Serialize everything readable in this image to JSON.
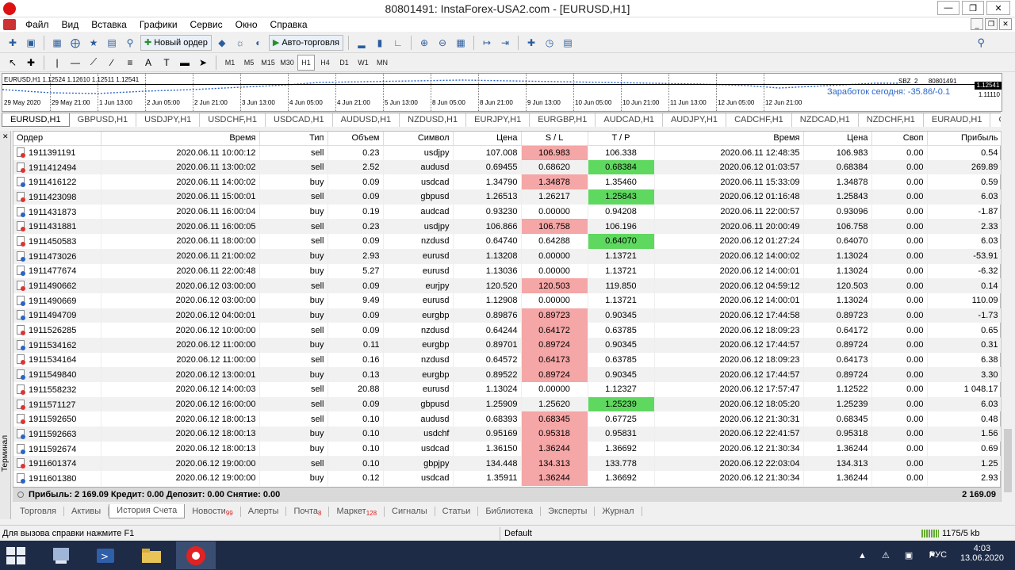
{
  "window": {
    "title": "80801491: InstaForex-USA2.com - [EURUSD,H1]"
  },
  "menu": [
    "Файл",
    "Вид",
    "Вставка",
    "Графики",
    "Сервис",
    "Окно",
    "Справка"
  ],
  "toolbar": {
    "new_order": "Новый ордер",
    "auto_trading": "Авто-торговля"
  },
  "timeframes": [
    "M1",
    "M5",
    "M15",
    "M30",
    "H1",
    "H4",
    "D1",
    "W1",
    "MN"
  ],
  "selected_timeframe": "H1",
  "chart": {
    "header": "EURUSD,H1  1.12524 1.12610 1.12511 1.12541",
    "expert": "SBZ_2",
    "account": "80801491",
    "earnings": "Заработок сегодня: -35.86/-0.1",
    "price": "1.12541",
    "price2": "1.11110",
    "xlabels": [
      "29 May 2020",
      "29 May 21:00",
      "1 Jun 13:00",
      "2 Jun 05:00",
      "2 Jun 21:00",
      "3 Jun 13:00",
      "4 Jun 05:00",
      "4 Jun 21:00",
      "5 Jun 13:00",
      "8 Jun 05:00",
      "8 Jun 21:00",
      "9 Jun 13:00",
      "10 Jun 05:00",
      "10 Jun 21:00",
      "11 Jun 13:00",
      "12 Jun 05:00",
      "12 Jun 21:00"
    ]
  },
  "symbol_tabs": [
    "EURUSD,H1",
    "GBPUSD,H1",
    "USDJPY,H1",
    "USDCHF,H1",
    "USDCAD,H1",
    "AUDUSD,H1",
    "NZDUSD,H1",
    "EURJPY,H1",
    "EURGBP,H1",
    "AUDCAD,H1",
    "AUDJPY,H1",
    "CADCHF,H1",
    "NZDCAD,H1",
    "NZDCHF,H1",
    "EURAUD,H1",
    "GBPCI"
  ],
  "columns": [
    "Ордер",
    "Время",
    "Тип",
    "Объем",
    "Символ",
    "Цена",
    "S / L",
    "T / P",
    "Время",
    "Цена",
    "Своп",
    "Прибыль"
  ],
  "rows": [
    [
      "1911391191",
      "2020.06.11 10:00:12",
      "sell",
      "0.23",
      "usdjpy",
      "107.008",
      "106.983",
      "106.338",
      "2020.06.11 12:48:35",
      "106.983",
      "0.00",
      "0.54",
      "red",
      ""
    ],
    [
      "1911412494",
      "2020.06.11 13:00:02",
      "sell",
      "2.52",
      "audusd",
      "0.69455",
      "0.68620",
      "0.68384",
      "2020.06.12 01:03:57",
      "0.68384",
      "0.00",
      "269.89",
      "",
      "green"
    ],
    [
      "1911416122",
      "2020.06.11 14:00:02",
      "buy",
      "0.09",
      "usdcad",
      "1.34790",
      "1.34878",
      "1.35460",
      "2020.06.11 15:33:09",
      "1.34878",
      "0.00",
      "0.59",
      "red",
      ""
    ],
    [
      "1911423098",
      "2020.06.11 15:00:01",
      "sell",
      "0.09",
      "gbpusd",
      "1.26513",
      "1.26217",
      "1.25843",
      "2020.06.12 01:16:48",
      "1.25843",
      "0.00",
      "6.03",
      "",
      "green"
    ],
    [
      "1911431873",
      "2020.06.11 16:00:04",
      "buy",
      "0.19",
      "audcad",
      "0.93230",
      "0.00000",
      "0.94208",
      "2020.06.11 22:00:57",
      "0.93096",
      "0.00",
      "-1.87",
      "",
      ""
    ],
    [
      "1911431881",
      "2020.06.11 16:00:05",
      "sell",
      "0.23",
      "usdjpy",
      "106.866",
      "106.758",
      "106.196",
      "2020.06.11 20:00:49",
      "106.758",
      "0.00",
      "2.33",
      "red",
      ""
    ],
    [
      "1911450583",
      "2020.06.11 18:00:00",
      "sell",
      "0.09",
      "nzdusd",
      "0.64740",
      "0.64288",
      "0.64070",
      "2020.06.12 01:27:24",
      "0.64070",
      "0.00",
      "6.03",
      "",
      "green"
    ],
    [
      "1911473026",
      "2020.06.11 21:00:02",
      "buy",
      "2.93",
      "eurusd",
      "1.13208",
      "0.00000",
      "1.13721",
      "2020.06.12 14:00:02",
      "1.13024",
      "0.00",
      "-53.91",
      "",
      ""
    ],
    [
      "1911477674",
      "2020.06.11 22:00:48",
      "buy",
      "5.27",
      "eurusd",
      "1.13036",
      "0.00000",
      "1.13721",
      "2020.06.12 14:00:01",
      "1.13024",
      "0.00",
      "-6.32",
      "",
      ""
    ],
    [
      "1911490662",
      "2020.06.12 03:00:00",
      "sell",
      "0.09",
      "eurjpy",
      "120.520",
      "120.503",
      "119.850",
      "2020.06.12 04:59:12",
      "120.503",
      "0.00",
      "0.14",
      "red",
      ""
    ],
    [
      "1911490669",
      "2020.06.12 03:00:00",
      "buy",
      "9.49",
      "eurusd",
      "1.12908",
      "0.00000",
      "1.13721",
      "2020.06.12 14:00:01",
      "1.13024",
      "0.00",
      "110.09",
      "",
      ""
    ],
    [
      "1911494709",
      "2020.06.12 04:00:01",
      "buy",
      "0.09",
      "eurgbp",
      "0.89876",
      "0.89723",
      "0.90345",
      "2020.06.12 17:44:58",
      "0.89723",
      "0.00",
      "-1.73",
      "red",
      ""
    ],
    [
      "1911526285",
      "2020.06.12 10:00:00",
      "sell",
      "0.09",
      "nzdusd",
      "0.64244",
      "0.64172",
      "0.63785",
      "2020.06.12 18:09:23",
      "0.64172",
      "0.00",
      "0.65",
      "red",
      ""
    ],
    [
      "1911534162",
      "2020.06.12 11:00:00",
      "buy",
      "0.11",
      "eurgbp",
      "0.89701",
      "0.89724",
      "0.90345",
      "2020.06.12 17:44:57",
      "0.89724",
      "0.00",
      "0.31",
      "red",
      ""
    ],
    [
      "1911534164",
      "2020.06.12 11:00:00",
      "sell",
      "0.16",
      "nzdusd",
      "0.64572",
      "0.64173",
      "0.63785",
      "2020.06.12 18:09:23",
      "0.64173",
      "0.00",
      "6.38",
      "red",
      ""
    ],
    [
      "1911549840",
      "2020.06.12 13:00:01",
      "buy",
      "0.13",
      "eurgbp",
      "0.89522",
      "0.89724",
      "0.90345",
      "2020.06.12 17:44:57",
      "0.89724",
      "0.00",
      "3.30",
      "red",
      ""
    ],
    [
      "1911558232",
      "2020.06.12 14:00:03",
      "sell",
      "20.88",
      "eurusd",
      "1.13024",
      "0.00000",
      "1.12327",
      "2020.06.12 17:57:47",
      "1.12522",
      "0.00",
      "1 048.17",
      "",
      ""
    ],
    [
      "1911571127",
      "2020.06.12 16:00:00",
      "sell",
      "0.09",
      "gbpusd",
      "1.25909",
      "1.25620",
      "1.25239",
      "2020.06.12 18:05:20",
      "1.25239",
      "0.00",
      "6.03",
      "",
      "green"
    ],
    [
      "1911592650",
      "2020.06.12 18:00:13",
      "sell",
      "0.10",
      "audusd",
      "0.68393",
      "0.68345",
      "0.67725",
      "2020.06.12 21:30:31",
      "0.68345",
      "0.00",
      "0.48",
      "red",
      ""
    ],
    [
      "1911592663",
      "2020.06.12 18:00:13",
      "buy",
      "0.10",
      "usdchf",
      "0.95169",
      "0.95318",
      "0.95831",
      "2020.06.12 22:41:57",
      "0.95318",
      "0.00",
      "1.56",
      "red",
      ""
    ],
    [
      "1911592674",
      "2020.06.12 18:00:13",
      "buy",
      "0.10",
      "usdcad",
      "1.36150",
      "1.36244",
      "1.36692",
      "2020.06.12 21:30:34",
      "1.36244",
      "0.00",
      "0.69",
      "red",
      ""
    ],
    [
      "1911601374",
      "2020.06.12 19:00:00",
      "sell",
      "0.10",
      "gbpjpy",
      "134.448",
      "134.313",
      "133.778",
      "2020.06.12 22:03:04",
      "134.313",
      "0.00",
      "1.25",
      "red",
      ""
    ],
    [
      "1911601380",
      "2020.06.12 19:00:00",
      "buy",
      "0.12",
      "usdcad",
      "1.35911",
      "1.36244",
      "1.36692",
      "2020.06.12 21:30:34",
      "1.36244",
      "0.00",
      "2.93",
      "red",
      ""
    ]
  ],
  "summary": {
    "text": "Прибыль: 2 169.09  Кредит: 0.00  Депозит: 0.00  Снятие: 0.00",
    "total": "2 169.09"
  },
  "terminal_label": "Терминал",
  "bottom_tabs": [
    {
      "label": "Торговля",
      "badge": ""
    },
    {
      "label": "Активы",
      "badge": ""
    },
    {
      "label": "История Счета",
      "badge": ""
    },
    {
      "label": "Новости",
      "badge": "99"
    },
    {
      "label": "Алерты",
      "badge": ""
    },
    {
      "label": "Почта",
      "badge": "8"
    },
    {
      "label": "Маркет",
      "badge": "128"
    },
    {
      "label": "Сигналы",
      "badge": ""
    },
    {
      "label": "Статьи",
      "badge": ""
    },
    {
      "label": "Библиотека",
      "badge": ""
    },
    {
      "label": "Эксперты",
      "badge": ""
    },
    {
      "label": "Журнал",
      "badge": ""
    }
  ],
  "active_bottom_tab": "История Счета",
  "status": {
    "help": "Для вызова справки нажмите F1",
    "profile": "Default",
    "net": "1175/5 kb"
  },
  "taskbar": {
    "lang": "РУС",
    "time": "4:03",
    "date": "13.06.2020"
  },
  "colors": {
    "sl_hit": "#f5a6a6",
    "tp_hit": "#5fd85f",
    "accent": "#2a5d9e"
  }
}
